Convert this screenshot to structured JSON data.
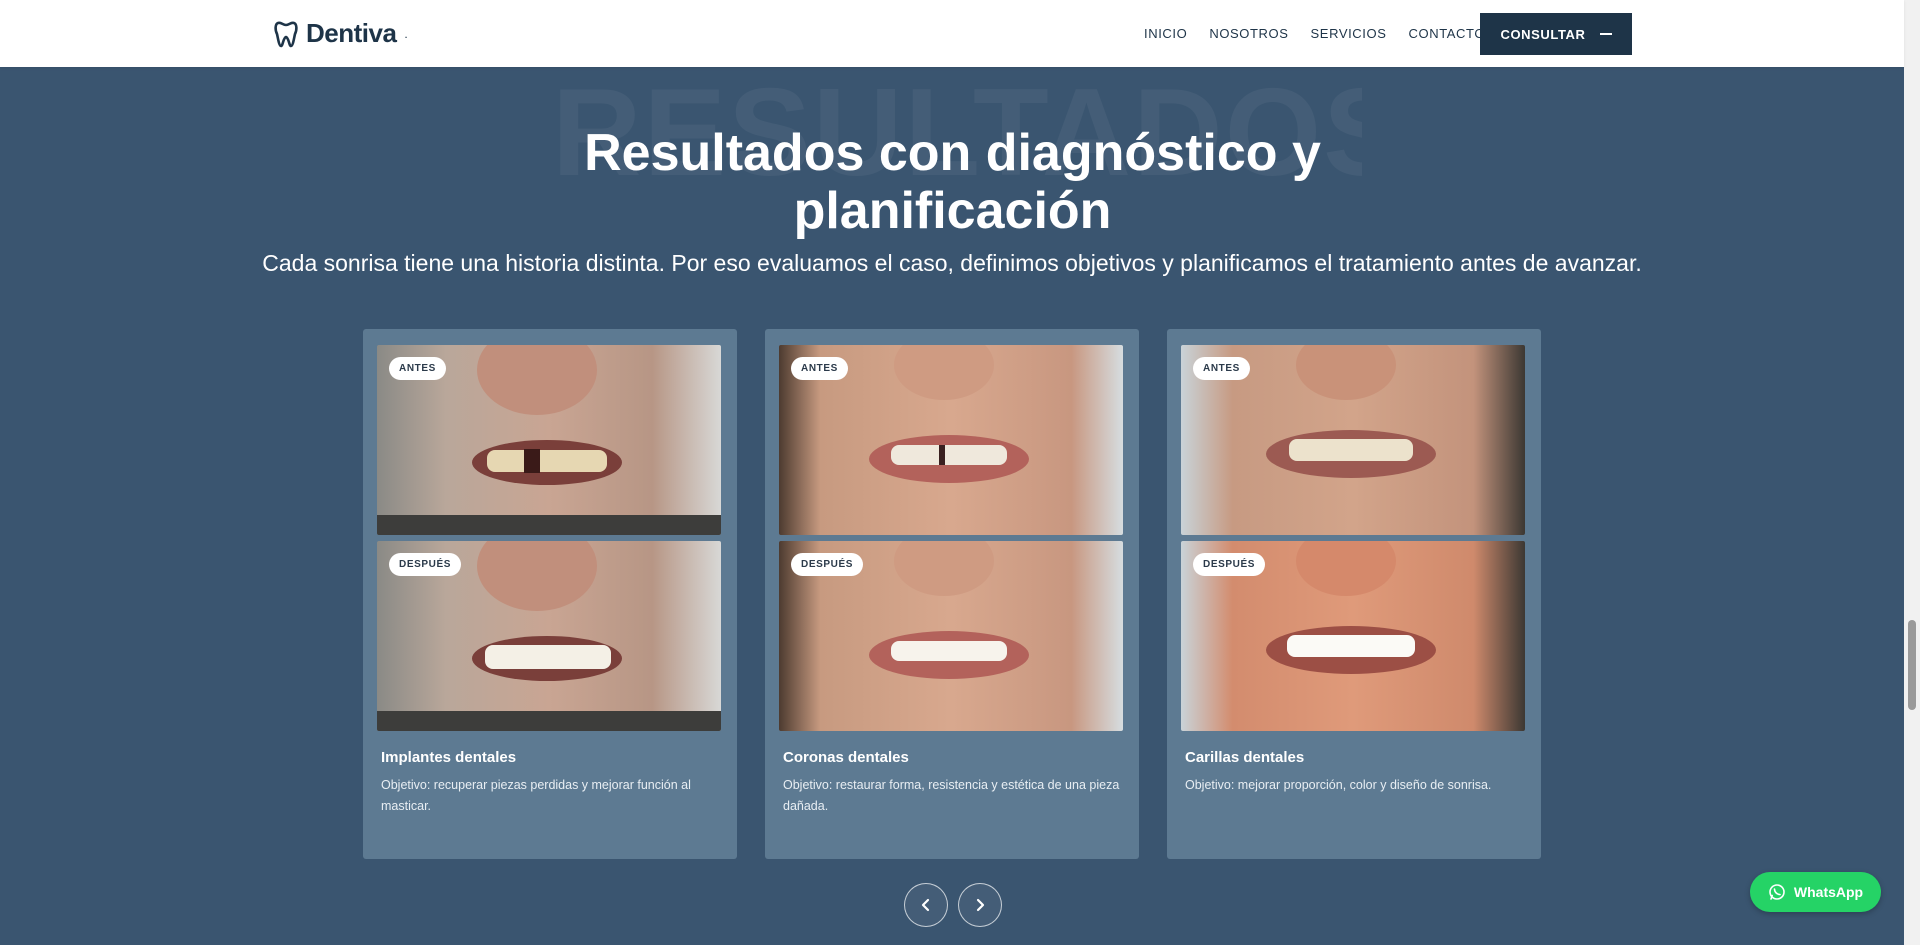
{
  "brand": {
    "name": "Dentiva",
    "dot": "."
  },
  "nav": {
    "links": [
      "INICIO",
      "NOSOTROS",
      "SERVICIOS",
      "CONTACTO"
    ],
    "cta_label": "CONSULTAR"
  },
  "hero": {
    "bg_word": "RESULTADOS",
    "title": "Resultados con diagnóstico y planificación",
    "subtitle": "Cada sonrisa tiene una historia distinta. Por eso evaluamos el caso, definimos objetivos y planificamos el tratamiento antes de avanzar."
  },
  "cases": [
    {
      "before_label": "ANTES",
      "after_label": "DESPUÉS",
      "title": "Implantes dentales",
      "description": "Objetivo: recuperar piezas perdidas y mejorar función al masticar."
    },
    {
      "before_label": "ANTES",
      "after_label": "DESPUÉS",
      "title": "Coronas dentales",
      "description": "Objetivo: restaurar forma, resistencia y estética de una pieza dañada."
    },
    {
      "before_label": "ANTES",
      "after_label": "DESPUÉS",
      "title": "Carillas dentales",
      "description": "Objetivo: mejorar proporción, color y diseño de sonrisa."
    }
  ],
  "carousel": {
    "prev_icon": "chevron-left-icon",
    "next_icon": "chevron-right-icon"
  },
  "whatsapp": {
    "label": "WhatsApp",
    "icon": "whatsapp-icon"
  },
  "colors": {
    "navy": "#1e3448",
    "section_bg": "#3a5570",
    "card_bg": "#5d7a92",
    "whatsapp_green": "#25d366"
  }
}
